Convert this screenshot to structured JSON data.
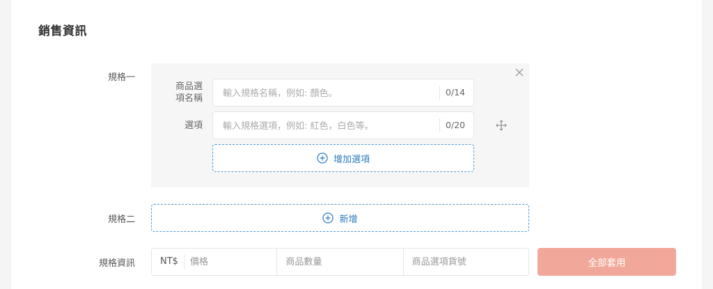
{
  "section": {
    "title": "銷售資訊"
  },
  "spec1": {
    "label": "規格一",
    "name_label_line1": "商品選",
    "name_label_line2": "項名稱",
    "name_placeholder": "輸入規格名稱，例如: 顏色。",
    "name_counter": "0/14",
    "option_label": "選項",
    "option_placeholder": "輸入規格選項，例如: 紅色，白色等。",
    "option_counter": "0/20",
    "add_option_label": "增加選項"
  },
  "spec2": {
    "label": "規格二",
    "add_label": "新增"
  },
  "spec_info": {
    "label": "規格資訊",
    "currency": "NT$",
    "price_placeholder": "價格",
    "quantity_placeholder": "商品數量",
    "sku_placeholder": "商品選項貨號",
    "apply_label": "全部套用"
  },
  "colors": {
    "accent": "#2a7ac0",
    "dashed_border": "#4a9ad6",
    "apply_button": "#f1a89a"
  }
}
